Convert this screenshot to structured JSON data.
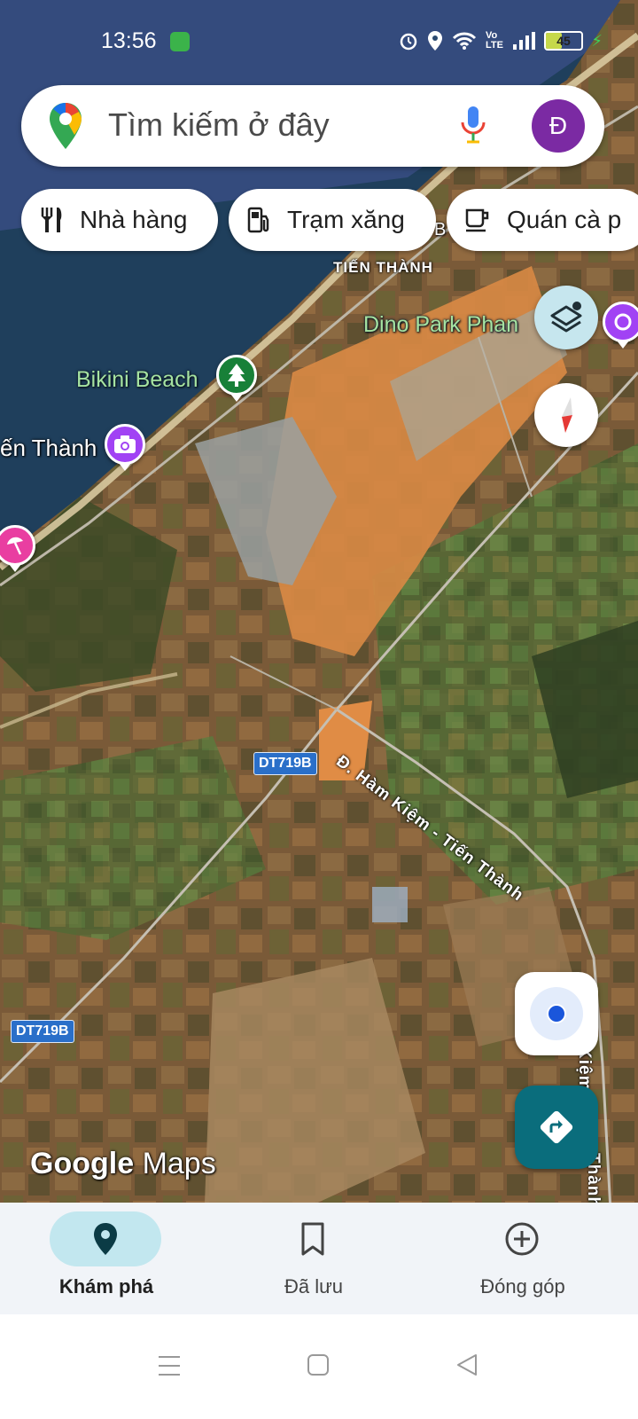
{
  "status_bar": {
    "time": "13:56",
    "battery": "45",
    "battery_level": 0.45,
    "icons": [
      "alarm-icon",
      "location-icon",
      "wifi-icon",
      "volte-icon",
      "signal-icon",
      "battery-icon",
      "charging-icon"
    ],
    "volte_line1": "Vo",
    "volte_line2": "LTE"
  },
  "search": {
    "placeholder": "Tìm kiếm ở đây",
    "avatar_letter": "Đ",
    "avatar_color": "#7b2aa3"
  },
  "chips": [
    {
      "label": "Nhà hàng",
      "icon": "restaurant-icon"
    },
    {
      "label": "Trạm xăng",
      "icon": "gas-station-icon"
    },
    {
      "label": "Quán cà p",
      "icon": "coffee-icon"
    }
  ],
  "map": {
    "labels": {
      "tien_thanh_top": "TIẾN THÀNH",
      "dino_park": "Dino Park Phan",
      "bikini_beach": "Bikini Beach",
      "tien_thanh_left": "ến Thành",
      "road_name": "Đ. Hàm Kiệm - Tiến Thành",
      "road_edge": "Kiệm",
      "road_edge2": "Thành",
      "b_partial": "B"
    },
    "shields": [
      "DT719B",
      "DT719B"
    ],
    "attribution_google": "Google",
    "attribution_maps": "Maps"
  },
  "map_buttons": {
    "layers": "layers-icon",
    "compass": "compass-icon",
    "my_location": "my-location-icon",
    "directions": "directions-icon"
  },
  "bottom_nav": [
    {
      "label": "Khám phá",
      "icon": "explore-pin-icon",
      "active": true
    },
    {
      "label": "Đã lưu",
      "icon": "bookmark-icon",
      "active": false
    },
    {
      "label": "Đóng góp",
      "icon": "add-circle-icon",
      "active": false
    }
  ],
  "colors": {
    "accent_teal": "#0b7285",
    "active_pill": "#c2e7ef",
    "directions_bg": "#0a6d7c"
  }
}
